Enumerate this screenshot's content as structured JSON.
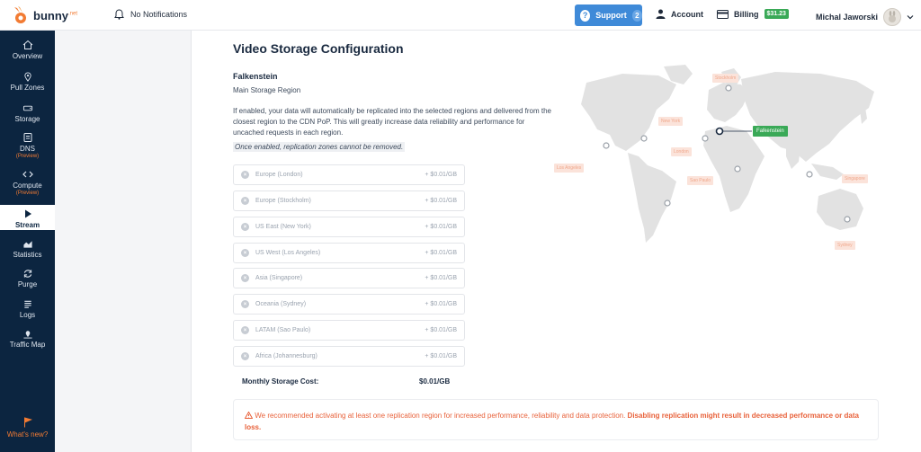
{
  "brand": {
    "name": "bunny",
    "suffix": ".net"
  },
  "topbar": {
    "notifications": "No Notifications",
    "support_label": "Support",
    "support_count": "2",
    "account_label": "Account",
    "billing_label": "Billing",
    "billing_amount": "$31.23",
    "user_name": "Michal Jaworski"
  },
  "sidebar": {
    "items": [
      {
        "label": "Overview",
        "sub": ""
      },
      {
        "label": "Pull Zones",
        "sub": ""
      },
      {
        "label": "Storage",
        "sub": ""
      },
      {
        "label": "DNS",
        "sub": "(Preview)"
      },
      {
        "label": "Compute",
        "sub": "(Preview)"
      },
      {
        "label": "Stream",
        "sub": ""
      },
      {
        "label": "Statistics",
        "sub": ""
      },
      {
        "label": "Purge",
        "sub": ""
      },
      {
        "label": "Logs",
        "sub": ""
      },
      {
        "label": "Traffic Map",
        "sub": ""
      }
    ],
    "whats_new": "What's new?"
  },
  "main": {
    "title": "Video Storage Configuration",
    "region_name": "Falkenstein",
    "region_sub": "Main Storage Region",
    "description": "If enabled, your data will automatically be replicated into the selected regions and delivered from the closest region to the CDN PoP. This will greatly increase data reliability and performance for uncached requests in each region.",
    "note": "Once enabled, replication zones cannot be removed.",
    "zones": [
      {
        "name": "Europe (London)",
        "price": "+ $0.01/GB"
      },
      {
        "name": "Europe (Stockholm)",
        "price": "+ $0.01/GB"
      },
      {
        "name": "US East (New York)",
        "price": "+ $0.01/GB"
      },
      {
        "name": "US West (Los Angeles)",
        "price": "+ $0.01/GB"
      },
      {
        "name": "Asia (Singapore)",
        "price": "+ $0.01/GB"
      },
      {
        "name": "Oceania (Sydney)",
        "price": "+ $0.01/GB"
      },
      {
        "name": "LATAM (Sao Paulo)",
        "price": "+ $0.01/GB"
      },
      {
        "name": "Africa (Johannesburg)",
        "price": "+ $0.01/GB"
      }
    ],
    "cost_label": "Monthly Storage Cost:",
    "cost_value": "$0.01/GB",
    "warning_text": "We recommended activating at least one replication region for increased performance, reliability and data protection.",
    "warning_bold": "Disabling replication might result in decreased performance or data loss."
  },
  "map": {
    "active_label": "Falkenstein",
    "labels": [
      "Stockholm",
      "New York",
      "London",
      "Los Angeles",
      "Sao Paulo",
      "Singapore",
      "Sydney"
    ]
  },
  "colors": {
    "sidebar_bg": "#0c2540",
    "accent_orange": "#f27b33",
    "support_blue": "#3f8ad8",
    "billing_green": "#3aa957",
    "warning": "#e8613a"
  }
}
